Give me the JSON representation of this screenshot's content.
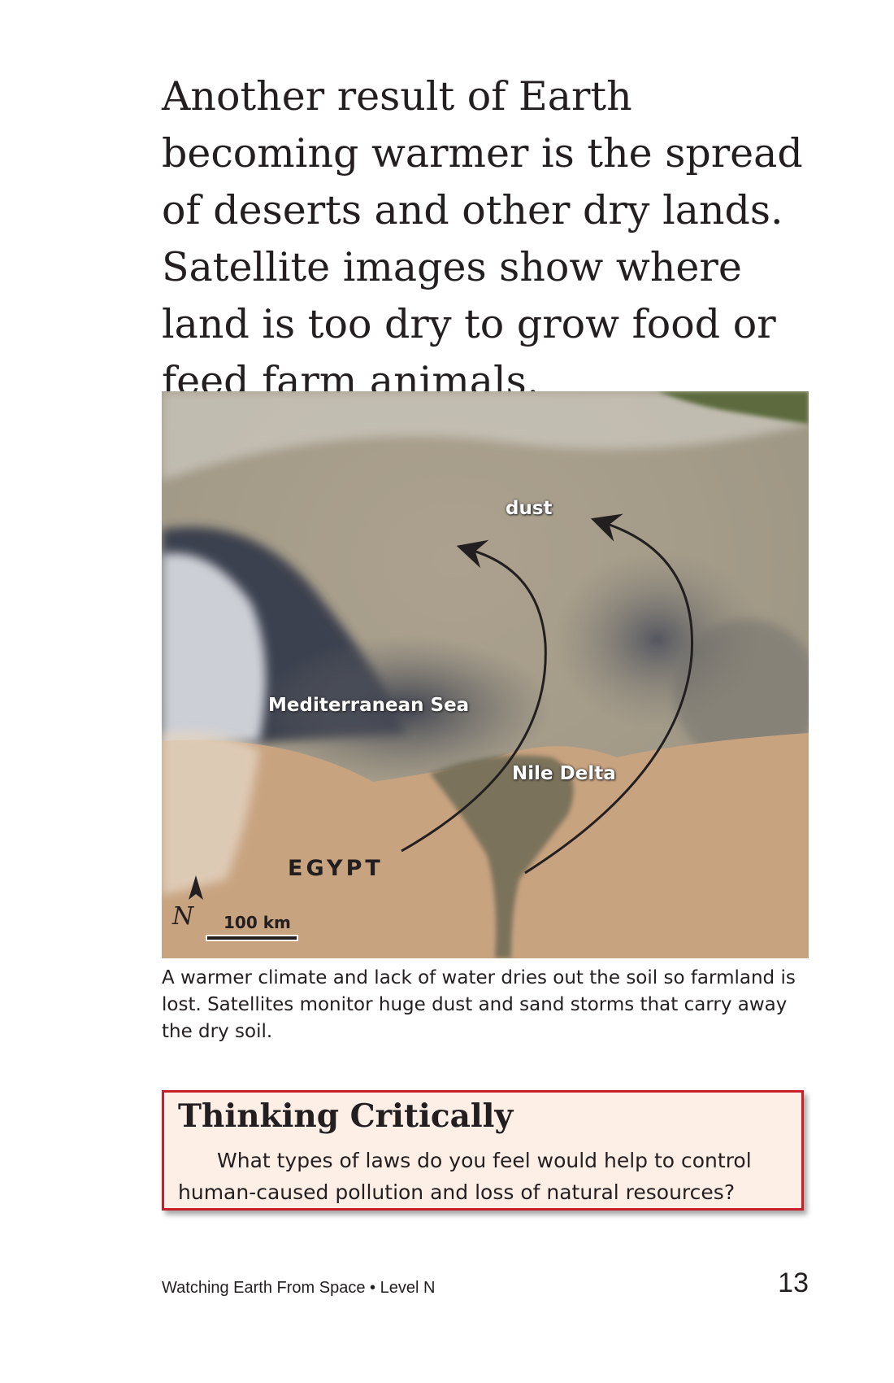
{
  "body_text": "Another result of Earth becoming warmer is the spread of deserts and other dry lands. Satellite images show where land is too dry to grow food or feed farm animals.",
  "figure": {
    "labels": {
      "dust": "dust",
      "sea": "Mediterranean Sea",
      "delta": "Nile Delta",
      "country": "EGYPT",
      "scale": "100 km",
      "north": "N"
    },
    "caption": "A warmer climate and lack of water dries out the soil so farmland is lost. Satellites monitor huge dust and sand storms that carry away the dry soil."
  },
  "callout": {
    "title": "Thinking Critically",
    "body": "What types of laws do you feel would help to control human-caused pollution and loss of natural resources?",
    "border_color": "#c8202a",
    "background_color": "#fdeee6"
  },
  "footer": {
    "book_title": "Watching Earth From Space • Level N",
    "page_number": "13"
  }
}
